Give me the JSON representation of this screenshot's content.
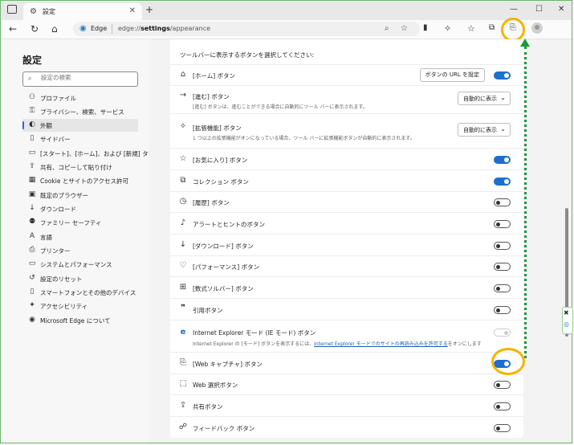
{
  "tab": {
    "title": "設定"
  },
  "address": {
    "label": "Edge",
    "url_prefix": "edge://",
    "url_bold": "settings",
    "url_suffix": "/appearance"
  },
  "sidebar": {
    "title": "設定",
    "search_placeholder": "設定の検索",
    "items": [
      {
        "label": "プロファイル",
        "icon": "person-icon"
      },
      {
        "label": "プライバシー、検索、サービス",
        "icon": "lock-icon"
      },
      {
        "label": "外観",
        "icon": "appearance-icon"
      },
      {
        "label": "サイドバー",
        "icon": "sidebar-icon"
      },
      {
        "label": "[スタート]、[ホーム]、および [新規] タブ",
        "icon": "home-tabs-icon"
      },
      {
        "label": "共有、コピーして貼り付け",
        "icon": "share-icon"
      },
      {
        "label": "Cookie とサイトのアクセス許可",
        "icon": "cookie-icon"
      },
      {
        "label": "既定のブラウザー",
        "icon": "browser-icon"
      },
      {
        "label": "ダウンロード",
        "icon": "download-icon"
      },
      {
        "label": "ファミリー セーフティ",
        "icon": "family-icon"
      },
      {
        "label": "言語",
        "icon": "language-icon"
      },
      {
        "label": "プリンター",
        "icon": "printer-icon"
      },
      {
        "label": "システムとパフォーマンス",
        "icon": "system-icon"
      },
      {
        "label": "設定のリセット",
        "icon": "reset-icon"
      },
      {
        "label": "スマートフォンとその他のデバイス",
        "icon": "phone-icon"
      },
      {
        "label": "アクセシビリティ",
        "icon": "accessibility-icon"
      },
      {
        "label": "Microsoft Edge について",
        "icon": "edge-icon"
      }
    ]
  },
  "section": {
    "heading": "ツールバーに表示するボタンを選択してください:"
  },
  "rows": {
    "home": {
      "title": "[ホーム] ボタン",
      "button": "ボタンの URL を設定"
    },
    "forward": {
      "title": "[進む] ボタン",
      "desc": "[進む] ボタンは、進むことができる場合に自動的にツール バーに表示されます。",
      "select": "自動的に表示"
    },
    "extensions": {
      "title": "[拡張機能] ボタン",
      "desc": "1 つ以上の拡張機能がオンになっている場合、ツール バーに拡張機能ボタンが自動的に表示されます。",
      "select": "自動的に表示"
    },
    "favorites": {
      "title": "[お気に入り] ボタン"
    },
    "collections": {
      "title": "コレクション ボタン"
    },
    "history": {
      "title": "[履歴] ボタン"
    },
    "alerts": {
      "title": "アラートとヒントのボタン"
    },
    "downloads": {
      "title": "[ダウンロード] ボタン"
    },
    "performance": {
      "title": "[パフォーマンス] ボタン"
    },
    "math": {
      "title": "[数式ソルバー] ボタン"
    },
    "citation": {
      "title": "引用ボタン"
    },
    "ie": {
      "title": "Internet Explorer モード (IE モード) ボタン",
      "desc_pre": "Internet Explorer の [モード] ボタンを表示するには、",
      "desc_link": "Internet Explorer モードでのサイトの再読み込みを許可する",
      "desc_post": "をオンにします"
    },
    "capture": {
      "title": "[Web キャプチャ] ボタン"
    },
    "select": {
      "title": "Web 選択ボタン"
    },
    "share": {
      "title": "共有ボタン"
    },
    "feedback": {
      "title": "フィードバック ボタン"
    }
  },
  "toggle_states": {
    "home": "on",
    "favorites": "on",
    "collections": "on",
    "history": "off",
    "alerts": "off",
    "downloads": "off",
    "performance": "off",
    "math": "off",
    "citation": "off",
    "ie": "disabled",
    "capture": "on",
    "select": "off",
    "share": "off",
    "feedback": "off"
  },
  "colors": {
    "accent": "#1d6fd0",
    "highlight": "#f5b300",
    "arrow": "#1a9a3a"
  }
}
